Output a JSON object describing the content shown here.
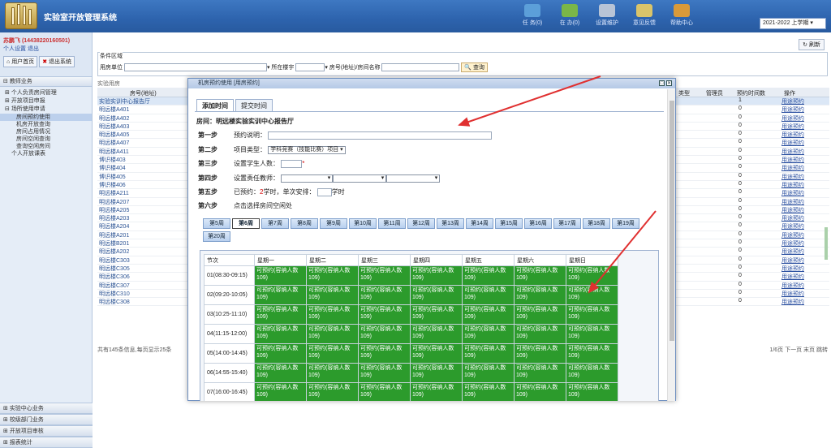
{
  "header": {
    "app_title": "实验室开放管理系统",
    "nav": [
      {
        "label": "任 务(0)",
        "icon": "task-icon",
        "color": "#5c9fd9"
      },
      {
        "label": "在 办(0)",
        "icon": "pending-icon",
        "color": "#7ab648"
      },
      {
        "label": "设置维护",
        "icon": "settings-icon",
        "color": "#b8c4d6"
      },
      {
        "label": "意见反馈",
        "icon": "feedback-icon",
        "color": "#d9c46a"
      },
      {
        "label": "帮助中心",
        "icon": "help-icon",
        "color": "#d99a3a"
      }
    ],
    "term": "2021-2022 上学期 ▾"
  },
  "sidebar": {
    "user_name": "苏鹏飞 (14438220160501)",
    "user_role": "个人设置 退出",
    "home_btn": "用户首页",
    "logout_btn": "退出系统",
    "section_title": "教师业务",
    "items": [
      "个人负责房间管理",
      "开放项目申报",
      "场所使用申请"
    ],
    "subitems": [
      "房间预约使用",
      "机房开放查询",
      "房间占用情况",
      "房间空闲查询",
      "查询空闲房间"
    ],
    "extra_item": "个人开放课表",
    "bottom_sections": [
      "实验中心业务",
      "校级部门业务",
      "开放项目审核",
      "报表统计"
    ]
  },
  "main": {
    "refresh": "刷新",
    "filter_legend": "条件区域",
    "filter_labels": {
      "unit": "用房单位",
      "building": "所在楼宇",
      "room": "房号(地址)/房间名称",
      "query": "查询"
    },
    "list_title": "实验用房",
    "headers": {
      "room": "房号(地址)",
      "type": "类型",
      "admin": "管理员",
      "count": "预约时间数",
      "op": "操作"
    },
    "rows": [
      {
        "name": "实验实训中心报告厅",
        "count": "1",
        "op": "用途预约"
      },
      {
        "name": "明远楼A401",
        "count": "0",
        "op": "用途预约"
      },
      {
        "name": "明远楼A402",
        "count": "0",
        "op": "用途预约"
      },
      {
        "name": "明远楼A403",
        "count": "0",
        "op": "用途预约"
      },
      {
        "name": "明远楼A405",
        "count": "0",
        "op": "用途预约"
      },
      {
        "name": "明远楼A407",
        "count": "0",
        "op": "用途预约"
      },
      {
        "name": "明远楼A411",
        "count": "0",
        "op": "用途预约"
      },
      {
        "name": "博识楼403",
        "count": "0",
        "op": "用途预约"
      },
      {
        "name": "博识楼404",
        "count": "0",
        "op": "用途预约"
      },
      {
        "name": "博识楼405",
        "count": "0",
        "op": "用途预约"
      },
      {
        "name": "博识楼406",
        "count": "0",
        "op": "用途预约"
      },
      {
        "name": "明远楼A211",
        "count": "0",
        "op": "用途预约"
      },
      {
        "name": "明远楼A207",
        "count": "0",
        "op": "用途预约"
      },
      {
        "name": "明远楼A205",
        "count": "0",
        "op": "用途预约"
      },
      {
        "name": "明远楼A203",
        "count": "0",
        "op": "用途预约"
      },
      {
        "name": "明远楼A204",
        "count": "0",
        "op": "用途预约"
      },
      {
        "name": "明远楼A201",
        "count": "0",
        "op": "用途预约"
      },
      {
        "name": "明远楼B201",
        "count": "0",
        "op": "用途预约"
      },
      {
        "name": "明远楼A202",
        "count": "0",
        "op": "用途预约"
      },
      {
        "name": "明远楼C303",
        "count": "0",
        "op": "用途预约"
      },
      {
        "name": "明远楼C305",
        "count": "0",
        "op": "用途预约"
      },
      {
        "name": "明远楼C306",
        "count": "0",
        "op": "用途预约"
      },
      {
        "name": "明远楼C307",
        "count": "0",
        "op": "用途预约"
      },
      {
        "name": "明远楼C310",
        "count": "0",
        "op": "用途预约"
      },
      {
        "name": "明远楼C308",
        "count": "0",
        "op": "用途预约"
      }
    ],
    "pager_left": "共有145条信息,每页显示25条",
    "pager_right": "1/6页 下一页 末页 跳转"
  },
  "modal": {
    "title": "机房预约使用 [用房预约]",
    "tabs": [
      "添加时间",
      "提交时间"
    ],
    "room_line": "房间：明远楼实验实训中心报告厅",
    "steps": [
      {
        "lbl": "第一步",
        "text": "预约说明："
      },
      {
        "lbl": "第二步",
        "text": "项目类型：",
        "value": "学科竞赛（技能比赛）项目 ▾"
      },
      {
        "lbl": "第三步",
        "text": "设置学生人数：",
        "star": "*"
      },
      {
        "lbl": "第四步",
        "text": "设置责任教师："
      },
      {
        "lbl": "第五步",
        "text": "已预约：",
        "hours": "2",
        "text2": "学时，单次安排：",
        "text3": "学时"
      },
      {
        "lbl": "第六步",
        "text": "点击选择房间空闲处"
      }
    ],
    "weeks": [
      "第5周",
      "第6周",
      "第7周",
      "第8周",
      "第9周",
      "第10周",
      "第11周",
      "第12周",
      "第13周",
      "第14周",
      "第15周",
      "第16周",
      "第17周",
      "第18周",
      "第19周",
      "第20周"
    ],
    "active_week": "第6周",
    "schedule": {
      "headers": [
        "节次",
        "星期一",
        "星期二",
        "星期三",
        "星期四",
        "星期五",
        "星期六",
        "星期日"
      ],
      "slots": [
        "01(08:30-09:15)",
        "02(09:20-10:05)",
        "03(10:25-11:10)",
        "04(11:15-12:00)",
        "05(14:00-14:45)",
        "06(14:55-15:40)",
        "07(16:00-16:45)"
      ],
      "cell_text": "可预约(容纳人数109)",
      "cell_color": "#2c9b2c"
    }
  }
}
